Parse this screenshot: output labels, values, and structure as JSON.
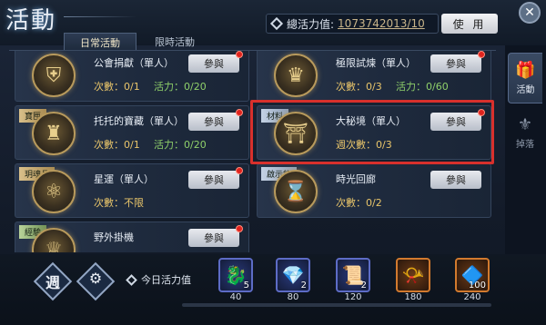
{
  "header": {
    "title": "活動",
    "vitality_label": "總活力值:",
    "vitality_value": "1073742013/10",
    "use_button": "使 用"
  },
  "tabs": [
    {
      "label": "日常活動",
      "active": true
    },
    {
      "label": "限時活動",
      "active": false
    }
  ],
  "side_tabs": [
    {
      "label": "活動",
      "icon": "gift-icon"
    },
    {
      "label": "掉落",
      "icon": "drop-icon"
    }
  ],
  "activities": [
    {
      "tag": "",
      "name": "公會捐獻（單人）",
      "count": "次數：0/1",
      "vitality": "活力：0/20",
      "join": "參與",
      "has_notice": true
    },
    {
      "tag": "",
      "name": "極限試煉（單人）",
      "count": "次數：0/3",
      "vitality": "活力：0/60",
      "join": "參與",
      "has_notice": true
    },
    {
      "tag": "寶匣",
      "name": "托托的寶藏（單人）",
      "count": "次數：0/1",
      "vitality": "活力：0/20",
      "join": "參與",
      "has_notice": true
    },
    {
      "tag": "材料",
      "name": "大秘境（單人）",
      "count": "週次數：0/3",
      "vitality": "",
      "join": "參與",
      "has_notice": true,
      "highlighted": true
    },
    {
      "tag": "玥魂晶",
      "name": "星運（單人）",
      "count": "次數：不限",
      "vitality": "",
      "join": "參與",
      "has_notice": true
    },
    {
      "tag": "啟示錄",
      "name": "時光回廊",
      "count": "次數：0/2",
      "vitality": "",
      "join": "參與",
      "has_notice": false
    },
    {
      "tag": "經驗",
      "name": "野外掛機",
      "count": "",
      "vitality": "",
      "join": "參與",
      "has_notice": true
    }
  ],
  "bottom": {
    "week_label": "週",
    "settings_icon": "gear-icon",
    "today_label": "今日活力值",
    "progress": 0.0,
    "rewards": [
      {
        "points": "40",
        "qty": "5",
        "icon": "blue-beast-icon"
      },
      {
        "points": "80",
        "qty": "2",
        "icon": "blue-crystal-icon"
      },
      {
        "points": "120",
        "qty": "2",
        "icon": "scroll-icon"
      },
      {
        "points": "180",
        "qty": "",
        "icon": "horn-icon"
      },
      {
        "points": "240",
        "qty": "100",
        "icon": "diamond-crystal-icon"
      }
    ]
  },
  "colors": {
    "highlight": "#d8302c",
    "notice_dot": "#e0231e",
    "count_text": "#e9c56a",
    "vitality_text": "#8fd06a"
  }
}
